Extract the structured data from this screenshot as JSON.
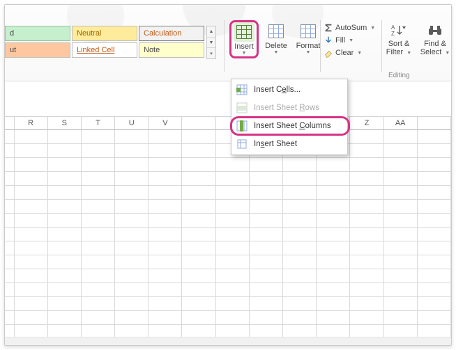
{
  "styles": {
    "row1": {
      "a": "d",
      "b": "Neutral",
      "c": "Calculation"
    },
    "row2": {
      "a": "ut",
      "b": "Linked Cell",
      "c": "Note"
    }
  },
  "cellsGroup": {
    "insert": "Insert",
    "delete": "Delete",
    "format": "Format"
  },
  "editing": {
    "autosum": "AutoSum",
    "fill": "Fill",
    "clear": "Clear",
    "sort": "Sort &",
    "filter": "Filter",
    "find": "Find &",
    "select": "Select",
    "groupLabel": "Editing"
  },
  "menu": {
    "cells_pre": "Insert C",
    "cells_u": "e",
    "cells_post": "lls...",
    "rows_pre": "Insert Sheet ",
    "rows_u": "R",
    "rows_post": "ows",
    "cols_pre": "Insert Sheet ",
    "cols_u": "C",
    "cols_post": "olumns",
    "sheet_pre": "In",
    "sheet_u": "s",
    "sheet_post": "ert Sheet"
  },
  "columns": [
    "R",
    "S",
    "T",
    "U",
    "V",
    "",
    "",
    "",
    "",
    "",
    "Z",
    "AA",
    ""
  ],
  "chart_data": null
}
